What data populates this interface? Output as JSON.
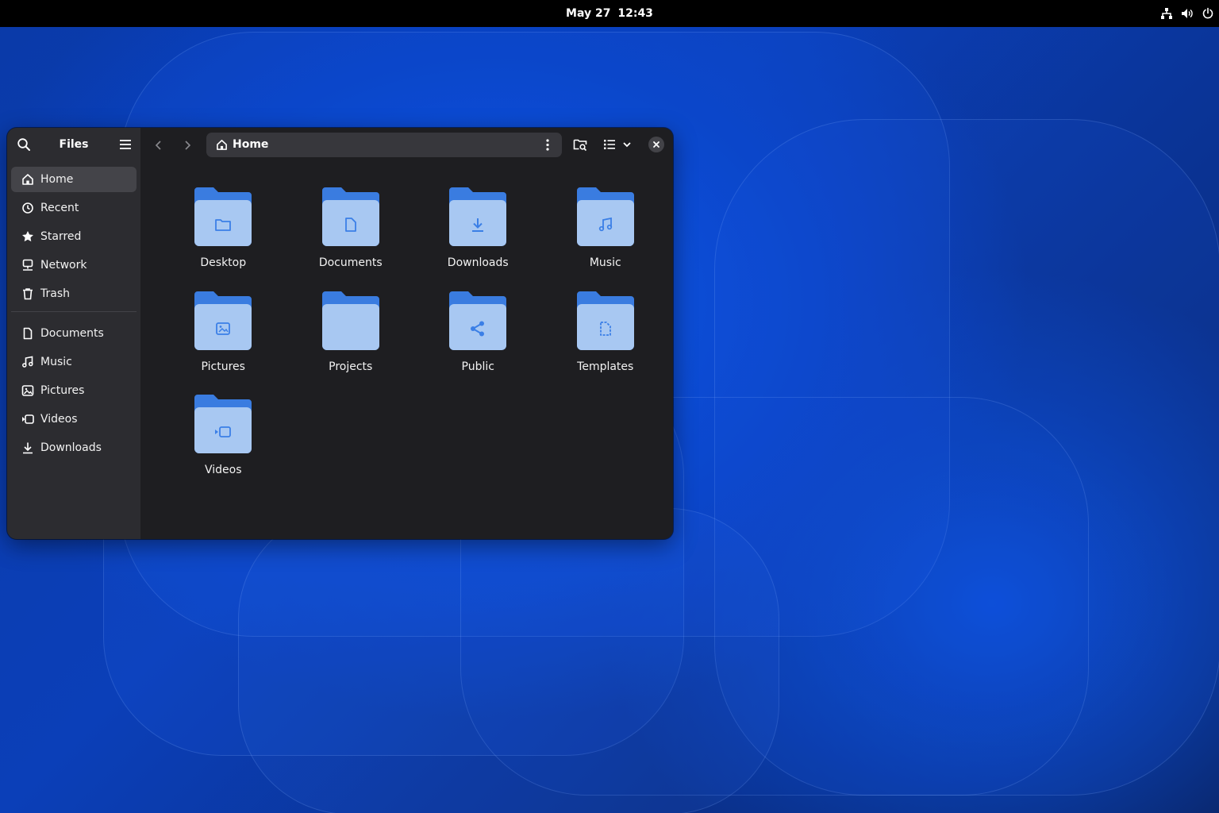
{
  "topbar": {
    "date": "May 27",
    "time": "12:43",
    "tray_icons": [
      "network-icon",
      "volume-icon",
      "power-icon"
    ]
  },
  "window": {
    "sidebar": {
      "title": "Files",
      "places": [
        {
          "label": "Home",
          "icon": "home-icon",
          "active": true
        },
        {
          "label": "Recent",
          "icon": "recent-icon"
        },
        {
          "label": "Starred",
          "icon": "star-icon"
        },
        {
          "label": "Network",
          "icon": "network-icon"
        },
        {
          "label": "Trash",
          "icon": "trash-icon"
        }
      ],
      "bookmarks": [
        {
          "label": "Documents",
          "icon": "document-icon"
        },
        {
          "label": "Music",
          "icon": "music-icon"
        },
        {
          "label": "Pictures",
          "icon": "picture-icon"
        },
        {
          "label": "Videos",
          "icon": "video-icon"
        },
        {
          "label": "Downloads",
          "icon": "download-icon"
        }
      ]
    },
    "pathbar": {
      "location": "Home"
    },
    "folders": [
      {
        "label": "Desktop",
        "emblem": "folder-emblem"
      },
      {
        "label": "Documents",
        "emblem": "document-emblem"
      },
      {
        "label": "Downloads",
        "emblem": "download-emblem"
      },
      {
        "label": "Music",
        "emblem": "music-emblem"
      },
      {
        "label": "Pictures",
        "emblem": "picture-emblem"
      },
      {
        "label": "Projects",
        "emblem": "none"
      },
      {
        "label": "Public",
        "emblem": "share-emblem"
      },
      {
        "label": "Templates",
        "emblem": "template-emblem"
      },
      {
        "label": "Videos",
        "emblem": "video-emblem"
      }
    ]
  },
  "colors": {
    "folder_back": "#3a7ce0",
    "folder_front": "#a8c8f2",
    "emblem": "#3b7fe6",
    "sidebar_bg": "#2c2c30",
    "content_bg": "#1e1e21",
    "accent_wallpaper": "#0a55e6"
  }
}
